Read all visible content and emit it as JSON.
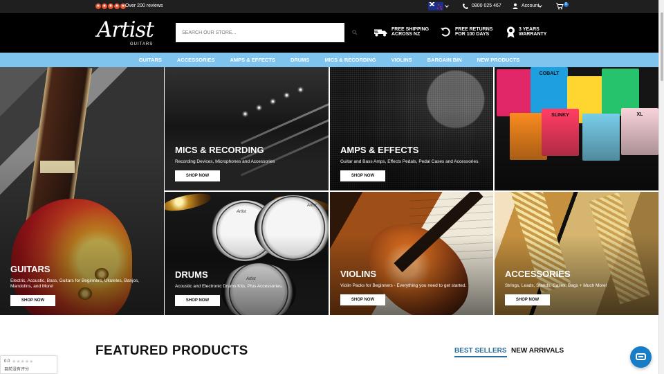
{
  "topbar": {
    "reviews": "Over 200 reviews",
    "phone": "0800 025 467",
    "account": "Account",
    "cart_count": "0",
    "star_icons": [
      "star-icon",
      "star-icon",
      "star-icon",
      "star-icon",
      "star-icon"
    ],
    "region_flag_icon": "new-zealand-flag-icon"
  },
  "header": {
    "logo": "Artist",
    "logo_subtitle": "GUITARS",
    "search_placeholder": "SEARCH OUR STORE...",
    "features": [
      {
        "icon": "truck-icon",
        "line1": "FREE SHIPPING",
        "line2": "ACROSS NZ"
      },
      {
        "icon": "return-icon",
        "line1": "FREE RETURNS",
        "line2": "FOR 100 DAYS"
      },
      {
        "icon": "warranty-icon",
        "line1": "3 YEARS",
        "line2": "WARRANTY"
      }
    ]
  },
  "nav": {
    "items": [
      "GUITARS",
      "ACCESSORIES",
      "AMPS & EFFECTS",
      "DRUMS",
      "MICS & RECORDING",
      "VIOLINS",
      "BARGAIN BIN",
      "NEW PRODUCTS"
    ]
  },
  "hero": {
    "tiles": [
      {
        "title": "GUITARS",
        "description": "Electric, Acoustic, Bass, Guitars for Beginners, Ukuleles, Banjos, Mandolins, and More!",
        "button": "SHOP NOW"
      },
      {
        "title": "MICS & RECORDING",
        "description": "Recording Devices, Microphones and Accessories",
        "button": "SHOP NOW"
      },
      {
        "title": "AMPS & EFFECTS",
        "description": "Guitar and Bass Amps, Effects Pedals, Pedal Cases and Accessories.",
        "button": "SHOP NOW"
      },
      {
        "title": "DRUMS",
        "description": "Acoustic and Electronic Drums Kits, Plus Accessories.",
        "button": "SHOP NOW"
      },
      {
        "title": "VIOLINS",
        "description": "Violin Packs for Beginners - Everything you need to get started.",
        "button": "SHOP NOW"
      },
      {
        "title": "ACCESSORIES",
        "description": "Strings, Leads, Stands, Cases, Bags + Much More!",
        "button": "SHOP NOW"
      }
    ],
    "packet_labels": [
      "COBALT",
      "SLINKY",
      "XL"
    ],
    "drum_labels": [
      "Artist",
      "Artist",
      "Artist"
    ]
  },
  "featured": {
    "heading": "FEATURED PRODUCTS",
    "tabs": [
      "BEST SELLERS",
      "NEW ARRIVALS"
    ]
  },
  "widget": {
    "rating": "0.0",
    "text": "目前没有评分"
  },
  "colors": {
    "nav": "#7ec4ef",
    "stars": "#e8542f",
    "accent": "#2a6d9a",
    "chat": "#177dc6"
  }
}
